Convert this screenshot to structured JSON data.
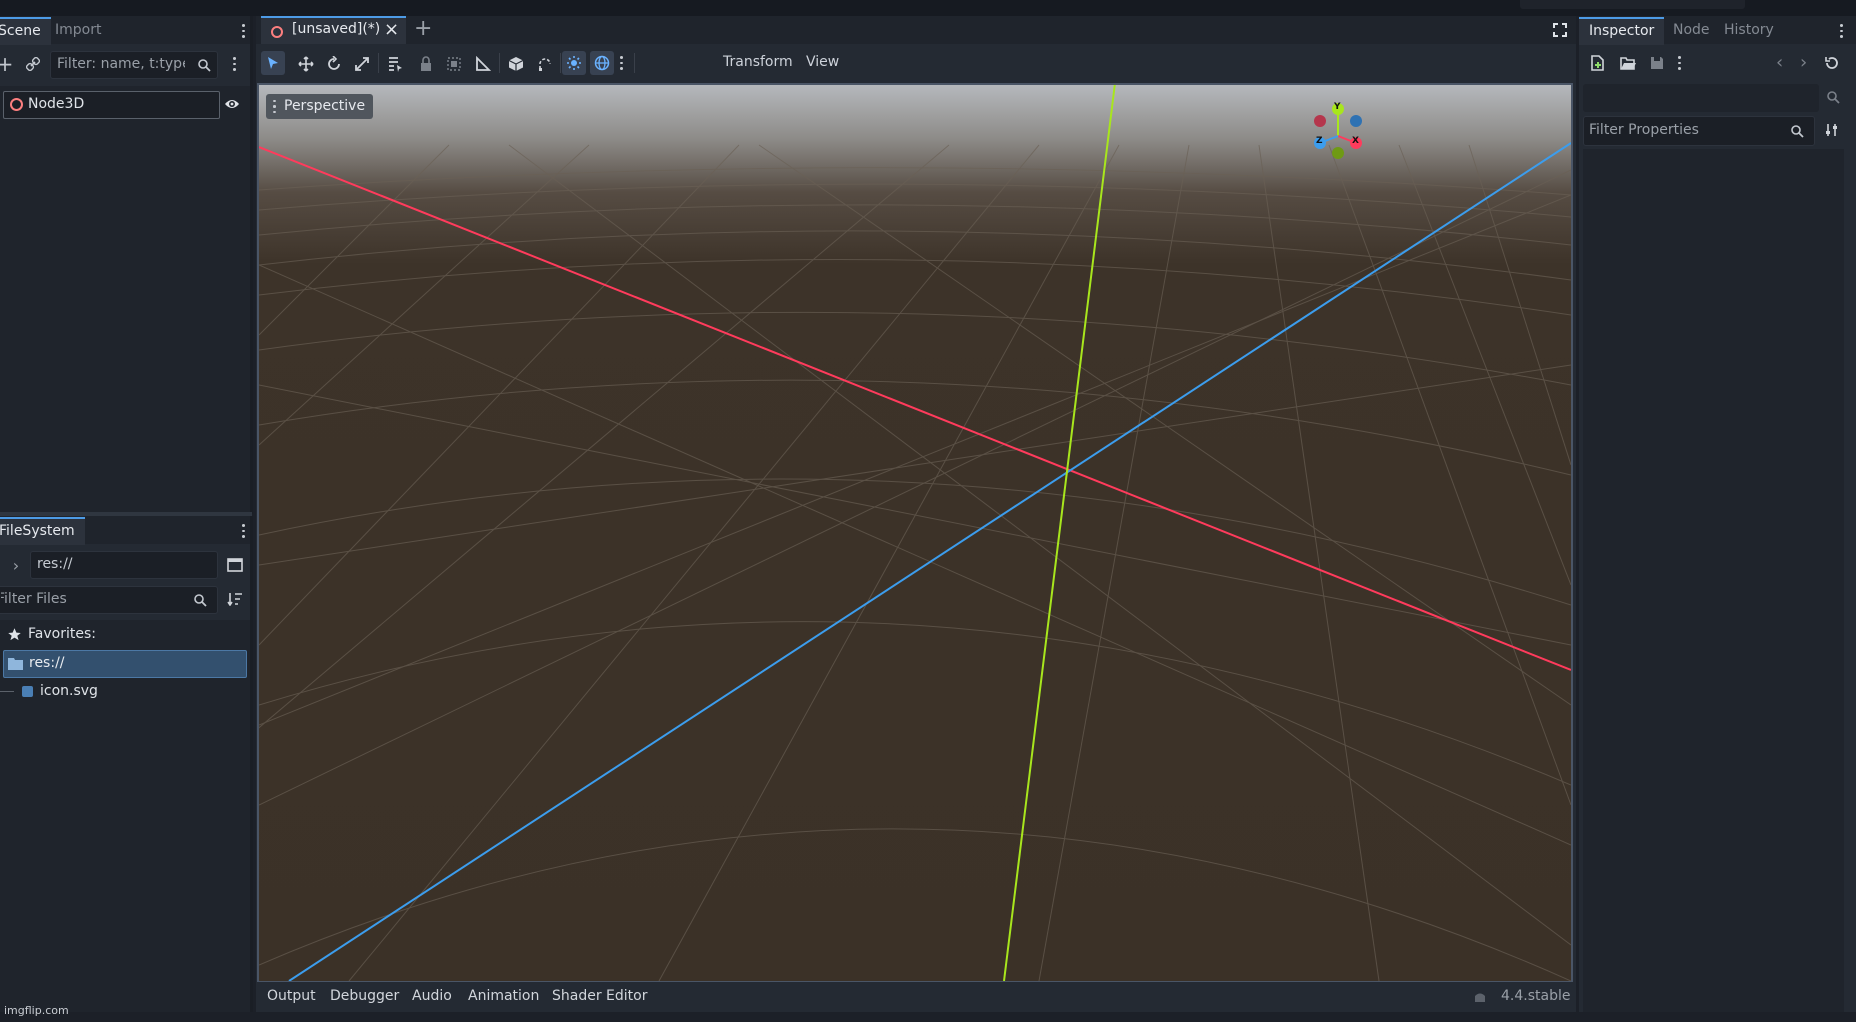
{
  "scene_dock": {
    "tabs": [
      "Scene",
      "Import"
    ],
    "filter_placeholder": "Filter: name, t:type,",
    "tree": [
      {
        "label": "Node3D"
      }
    ]
  },
  "filesystem_dock": {
    "title": "FileSystem",
    "path": "res://",
    "filter_placeholder": "Filter Files",
    "favorites_label": "Favorites:",
    "items": [
      {
        "label": "res://"
      },
      {
        "label": "icon.svg"
      }
    ]
  },
  "editor": {
    "scene_tab": "[unsaved](*)",
    "menus": [
      "Transform",
      "View"
    ],
    "viewport_label": "Perspective",
    "gizmo": {
      "y": "Y",
      "x": "X",
      "z": "Z"
    }
  },
  "bottom_panel": {
    "tabs": [
      "Output",
      "Debugger",
      "Audio",
      "Animation",
      "Shader Editor"
    ],
    "version": "4.4.stable"
  },
  "inspector": {
    "tabs": [
      "Inspector",
      "Node",
      "History"
    ],
    "filter_placeholder": "Filter Properties"
  },
  "watermark": "imgflip.com",
  "colors": {
    "accent": "#4d9be6",
    "x_axis": "#ff3b5c",
    "y_axis": "#a8e61d",
    "z_axis": "#3c9ded",
    "floor": "#3b3127"
  }
}
